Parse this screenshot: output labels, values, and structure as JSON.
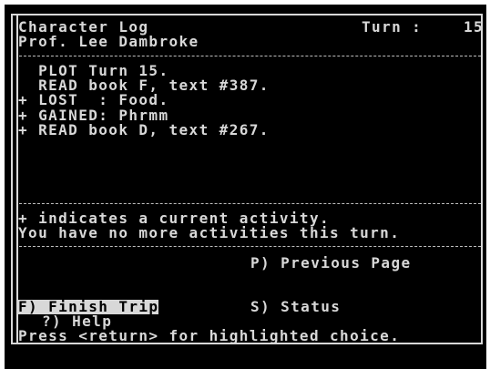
{
  "header": {
    "title": "Character Log",
    "turn_label": "Turn :",
    "turn_value": "15",
    "character_name": "Prof. Lee Dambroke"
  },
  "log": {
    "entries": [
      {
        "text": "  PLOT Turn 15."
      },
      {
        "text": "  READ book F, text #387."
      },
      {
        "text": "+ LOST  : Food."
      },
      {
        "text": "+ GAINED: Phrmm"
      },
      {
        "text": "+ READ book D, text #267."
      }
    ]
  },
  "notes": {
    "legend": "+ indicates a current activity.",
    "status": "You have no more activities this turn."
  },
  "menu": {
    "previous_page": "P) Previous Page",
    "finish_trip": "F) Finish Trip",
    "status": "S) Status",
    "help": "?) Help"
  },
  "prompt": "Press <return> for highlighted choice."
}
